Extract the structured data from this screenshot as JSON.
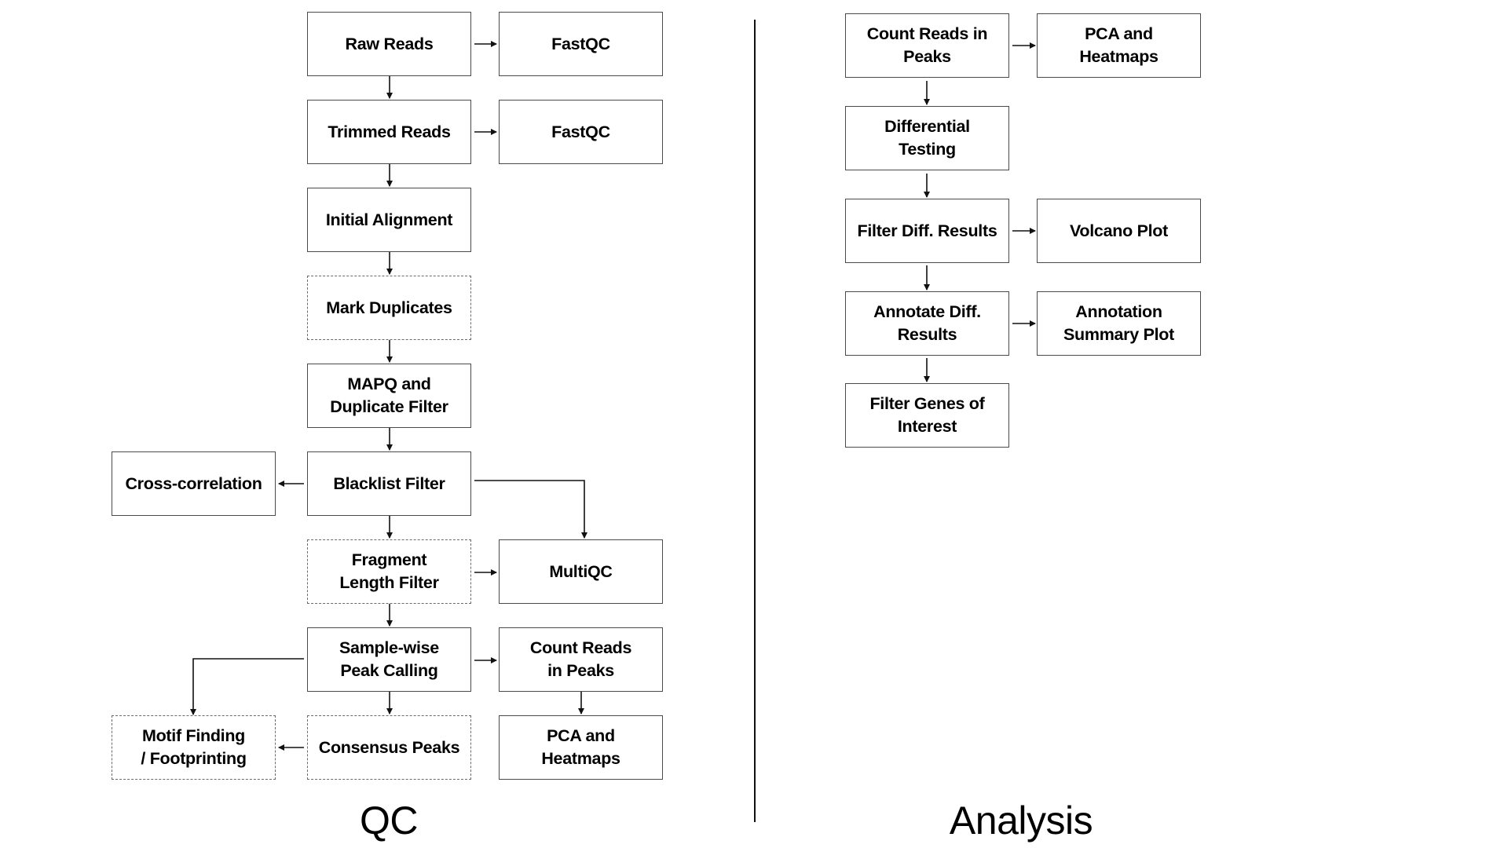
{
  "sections": {
    "qc": {
      "label": "QC",
      "nodes": {
        "raw_reads": "Raw Reads",
        "fastqc_raw": "FastQC",
        "trimmed_reads": "Trimmed Reads",
        "fastqc_trimmed": "FastQC",
        "initial_alignment": "Initial Alignment",
        "mark_duplicates": "Mark Duplicates",
        "mapq_filter": "MAPQ and\nDuplicate Filter",
        "blacklist_filter": "Blacklist Filter",
        "cross_correlation": "Cross-correlation",
        "fragment_length_filter": "Fragment\nLength Filter",
        "multiqc": "MultiQC",
        "peak_calling": "Sample-wise\nPeak Calling",
        "count_reads": "Count Reads\nin Peaks",
        "consensus_peaks": "Consensus Peaks",
        "motif_finding": "Motif Finding\n/ Footprinting",
        "pca_heatmaps": "PCA and\nHeatmaps"
      },
      "optional_steps": [
        "Mark Duplicates",
        "Fragment Length Filter",
        "Consensus Peaks",
        "Motif Finding / Footprinting"
      ]
    },
    "analysis": {
      "label": "Analysis",
      "nodes": {
        "count_reads": "Count Reads in\nPeaks",
        "pca_heatmaps": "PCA and\nHeatmaps",
        "differential_testing": "Differential\nTesting",
        "filter_diff_results": "Filter Diff. Results",
        "volcano_plot": "Volcano Plot",
        "annotate_diff_results": "Annotate Diff.\nResults",
        "annotation_summary_plot": "Annotation\nSummary Plot",
        "filter_genes": "Filter Genes of\nInterest"
      }
    }
  },
  "edges": [
    [
      "Raw Reads",
      "FastQC"
    ],
    [
      "Raw Reads",
      "Trimmed Reads"
    ],
    [
      "Trimmed Reads",
      "FastQC"
    ],
    [
      "Trimmed Reads",
      "Initial Alignment"
    ],
    [
      "Initial Alignment",
      "Mark Duplicates"
    ],
    [
      "Mark Duplicates",
      "MAPQ and Duplicate Filter"
    ],
    [
      "MAPQ and Duplicate Filter",
      "Blacklist Filter"
    ],
    [
      "Blacklist Filter",
      "Cross-correlation"
    ],
    [
      "Blacklist Filter",
      "MultiQC"
    ],
    [
      "Blacklist Filter",
      "Fragment Length Filter"
    ],
    [
      "Fragment Length Filter",
      "MultiQC"
    ],
    [
      "Fragment Length Filter",
      "Sample-wise Peak Calling"
    ],
    [
      "Sample-wise Peak Calling",
      "Count Reads in Peaks"
    ],
    [
      "Sample-wise Peak Calling",
      "Consensus Peaks"
    ],
    [
      "Sample-wise Peak Calling",
      "Motif Finding / Footprinting"
    ],
    [
      "Consensus Peaks",
      "Motif Finding / Footprinting"
    ],
    [
      "Count Reads in Peaks",
      "PCA and Heatmaps"
    ],
    [
      "Count Reads in Peaks (Analysis)",
      "PCA and Heatmaps (Analysis)"
    ],
    [
      "Count Reads in Peaks (Analysis)",
      "Differential Testing"
    ],
    [
      "Differential Testing",
      "Filter Diff. Results"
    ],
    [
      "Filter Diff. Results",
      "Volcano Plot"
    ],
    [
      "Filter Diff. Results",
      "Annotate Diff. Results"
    ],
    [
      "Annotate Diff. Results",
      "Annotation Summary Plot"
    ],
    [
      "Annotate Diff. Results",
      "Filter Genes of Interest"
    ]
  ],
  "colors": {
    "border": "#4a4a4a",
    "dashed_border": "#6a6a6a",
    "arrow": "#111111",
    "background": "#ffffff"
  }
}
